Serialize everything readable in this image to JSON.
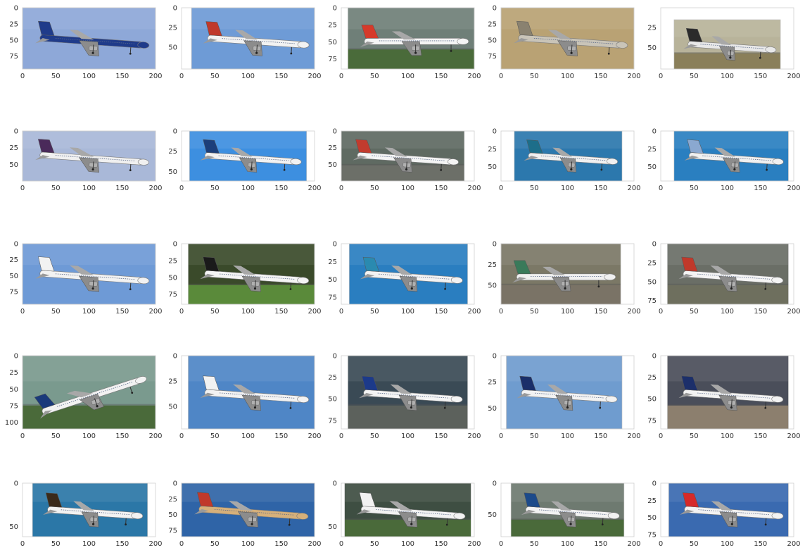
{
  "chart_data": {
    "type": "image_grid",
    "grid": {
      "rows": 5,
      "cols": 5
    },
    "axes_frame": false,
    "grid_lines": false,
    "panels": [
      {
        "xlim": [
          0,
          200
        ],
        "ylim": [
          95,
          0
        ],
        "image_extent": [
          0,
          200,
          0,
          95
        ],
        "x_ticks": [
          0,
          50,
          100,
          150,
          200
        ],
        "y_ticks": [
          0,
          25,
          50,
          75
        ],
        "sky": "#8ea8d8",
        "ground": null,
        "fuselage": "#1f3b8a",
        "tail": "#1f3b8a"
      },
      {
        "xlim": [
          0,
          200
        ],
        "ylim": [
          78,
          0
        ],
        "image_extent": [
          15,
          200,
          0,
          78
        ],
        "x_ticks": [
          0,
          50,
          100,
          150,
          200
        ],
        "y_ticks": [
          0,
          25,
          50
        ],
        "sky": "#6e9bd6",
        "ground": null,
        "fuselage": "#f2f2f2",
        "tail": "#c0392b"
      },
      {
        "xlim": [
          0,
          200
        ],
        "ylim": [
          90,
          0
        ],
        "image_extent": [
          10,
          200,
          0,
          90
        ],
        "x_ticks": [
          0,
          50,
          100,
          150,
          200
        ],
        "y_ticks": [
          0,
          25,
          50,
          75
        ],
        "sky": "#6f7f78",
        "ground": "#4a6b3a",
        "fuselage": "#f4f4f4",
        "tail": "#d63a2a"
      },
      {
        "xlim": [
          0,
          200
        ],
        "ylim": [
          95,
          0
        ],
        "image_extent": [
          0,
          200,
          0,
          95
        ],
        "x_ticks": [
          0,
          50,
          100,
          150,
          200
        ],
        "y_ticks": [
          0,
          25,
          50,
          75
        ],
        "sky": "#b9a274",
        "ground": null,
        "fuselage": "#c9c4b8",
        "tail": "#8a8270"
      },
      {
        "xlim": [
          0,
          200
        ],
        "ylim": [
          77,
          0
        ],
        "image_extent": [
          20,
          180,
          15,
          77
        ],
        "x_ticks": [
          0,
          50,
          100,
          150,
          200
        ],
        "y_ticks": [
          25,
          50
        ],
        "sky": "#b8b39a",
        "ground": "#8a7f5a",
        "fuselage": "#e8e8e8",
        "tail": "#2b2b2b"
      },
      {
        "xlim": [
          0,
          200
        ],
        "ylim": [
          75,
          0
        ],
        "image_extent": [
          0,
          200,
          0,
          75
        ],
        "x_ticks": [
          0,
          50,
          100,
          150,
          200
        ],
        "y_ticks": [
          0,
          25,
          50
        ],
        "sky": "#a9b8d8",
        "ground": null,
        "fuselage": "#f0f0f0",
        "tail": "#4a2a5a"
      },
      {
        "xlim": [
          0,
          200
        ],
        "ylim": [
          62,
          0
        ],
        "image_extent": [
          12,
          188,
          0,
          62
        ],
        "x_ticks": [
          0,
          50,
          100,
          150,
          200
        ],
        "y_ticks": [
          0,
          25,
          50
        ],
        "sky": "#3d8fe0",
        "ground": null,
        "fuselage": "#f2f2f2",
        "tail": "#1c3f7a"
      },
      {
        "xlim": [
          0,
          200
        ],
        "ylim": [
          75,
          0
        ],
        "image_extent": [
          0,
          185,
          0,
          75
        ],
        "x_ticks": [
          0,
          50,
          100,
          150,
          200
        ],
        "y_ticks": [
          0,
          25,
          50
        ],
        "sky": "#5f6a62",
        "ground": "#6c6f68",
        "fuselage": "#f4f4f4",
        "tail": "#c23b2e"
      },
      {
        "xlim": [
          0,
          200
        ],
        "ylim": [
          70,
          0
        ],
        "image_extent": [
          20,
          182,
          0,
          70
        ],
        "x_ticks": [
          0,
          50,
          100,
          150,
          200
        ],
        "y_ticks": [
          0,
          25,
          50
        ],
        "sky": "#2c78ad",
        "ground": null,
        "fuselage": "#f0f0f0",
        "tail": "#1d6e8a"
      },
      {
        "xlim": [
          0,
          200
        ],
        "ylim": [
          70,
          0
        ],
        "image_extent": [
          20,
          192,
          0,
          70
        ],
        "x_ticks": [
          0,
          50,
          100,
          150,
          200
        ],
        "y_ticks": [
          0,
          25,
          50
        ],
        "sky": "#2a7fc0",
        "ground": null,
        "fuselage": "#f0f0f0",
        "tail": "#8aa8d0"
      },
      {
        "xlim": [
          0,
          200
        ],
        "ylim": [
          95,
          0
        ],
        "image_extent": [
          0,
          200,
          0,
          95
        ],
        "x_ticks": [
          0,
          50,
          100,
          150,
          200
        ],
        "y_ticks": [
          0,
          25,
          50,
          75
        ],
        "sky": "#6e9ad6",
        "ground": null,
        "fuselage": "#f2f2f2",
        "tail": "#f2f2f2"
      },
      {
        "xlim": [
          0,
          200
        ],
        "ylim": [
          90,
          0
        ],
        "image_extent": [
          10,
          200,
          0,
          90
        ],
        "x_ticks": [
          0,
          50,
          100,
          150,
          200
        ],
        "y_ticks": [
          0,
          25,
          50,
          75
        ],
        "sky": "#3a4a2a",
        "ground": "#5a8a3a",
        "fuselage": "#f4f4f4",
        "tail": "#1a1a1a"
      },
      {
        "xlim": [
          0,
          200
        ],
        "ylim": [
          85,
          0
        ],
        "image_extent": [
          12,
          190,
          0,
          85
        ],
        "x_ticks": [
          0,
          50,
          100,
          150,
          200
        ],
        "y_ticks": [
          0,
          25,
          50,
          75
        ],
        "sky": "#2a7ec0",
        "ground": null,
        "fuselage": "#f2f2f2",
        "tail": "#2a8ab0"
      },
      {
        "xlim": [
          0,
          200
        ],
        "ylim": [
          73,
          0
        ],
        "image_extent": [
          0,
          180,
          0,
          73
        ],
        "x_ticks": [
          0,
          50,
          100,
          150,
          200
        ],
        "y_ticks": [
          0,
          25,
          50
        ],
        "sky": "#7b7866",
        "ground": "#7a7366",
        "fuselage": "#f0f0f0",
        "tail": "#3a7a5a"
      },
      {
        "xlim": [
          0,
          200
        ],
        "ylim": [
          80,
          0
        ],
        "image_extent": [
          10,
          192,
          0,
          80
        ],
        "x_ticks": [
          0,
          50,
          100,
          150,
          200
        ],
        "y_ticks": [
          0,
          25,
          50,
          75
        ],
        "sky": "#6a6e66",
        "ground": "#6e6f5e",
        "fuselage": "#f4f4f4",
        "tail": "#c0392b"
      },
      {
        "xlim": [
          0,
          200
        ],
        "ylim": [
          110,
          0
        ],
        "image_extent": [
          0,
          200,
          0,
          110
        ],
        "x_ticks": [
          0,
          50,
          100,
          150,
          200
        ],
        "y_ticks": [
          0,
          25,
          50,
          75,
          100
        ],
        "sky": "#7a9a8e",
        "ground": "#4a6a3a",
        "fuselage": "#f2f2f2",
        "tail": "#1a3a7a"
      },
      {
        "xlim": [
          0,
          200
        ],
        "ylim": [
          72,
          0
        ],
        "image_extent": [
          10,
          200,
          0,
          72
        ],
        "x_ticks": [
          0,
          50,
          100,
          150,
          200
        ],
        "y_ticks": [
          0,
          25,
          50
        ],
        "sky": "#4f86c6",
        "ground": null,
        "fuselage": "#f2f2f2",
        "tail": "#f2f2f2"
      },
      {
        "xlim": [
          0,
          200
        ],
        "ylim": [
          85,
          0
        ],
        "image_extent": [
          10,
          190,
          0,
          85
        ],
        "x_ticks": [
          0,
          50,
          100,
          150,
          200
        ],
        "y_ticks": [
          0,
          25,
          50,
          75
        ],
        "sky": "#3a4a55",
        "ground": "#5c615c",
        "fuselage": "#f4f4f4",
        "tail": "#1c3a8a"
      },
      {
        "xlim": [
          0,
          200
        ],
        "ylim": [
          70,
          0
        ],
        "image_extent": [
          8,
          182,
          0,
          70
        ],
        "x_ticks": [
          0,
          50,
          100,
          150,
          200
        ],
        "y_ticks": [
          0,
          25,
          50
        ],
        "sky": "#6f9ccf",
        "ground": null,
        "fuselage": "#f2f2f2",
        "tail": "#1a2f6a"
      },
      {
        "xlim": [
          0,
          200
        ],
        "ylim": [
          85,
          0
        ],
        "image_extent": [
          10,
          192,
          0,
          85
        ],
        "x_ticks": [
          0,
          50,
          100,
          150,
          200
        ],
        "y_ticks": [
          0,
          25,
          50,
          75
        ],
        "sky": "#4a4e5a",
        "ground": "#8c7f6e",
        "fuselage": "#f2f2f2",
        "tail": "#1c2f6a"
      },
      {
        "xlim": [
          0,
          200
        ],
        "ylim": [
          62,
          0
        ],
        "image_extent": [
          15,
          188,
          0,
          62
        ],
        "x_ticks": [
          0,
          50,
          100,
          150,
          200
        ],
        "y_ticks": [
          0,
          50
        ],
        "sky": "#2b77a7",
        "ground": null,
        "fuselage": "#f2f2f2",
        "tail": "#3a2a1a"
      },
      {
        "xlim": [
          0,
          200
        ],
        "ylim": [
          85,
          0
        ],
        "image_extent": [
          0,
          200,
          0,
          85
        ],
        "x_ticks": [
          0,
          50,
          100,
          150,
          200
        ],
        "y_ticks": [
          0,
          25,
          50,
          75
        ],
        "sky": "#2f64a7",
        "ground": null,
        "fuselage": "#d6b07a",
        "tail": "#c0392b"
      },
      {
        "xlim": [
          0,
          200
        ],
        "ylim": [
          62,
          0
        ],
        "image_extent": [
          5,
          195,
          0,
          62
        ],
        "x_ticks": [
          0,
          50,
          100,
          150,
          200
        ],
        "y_ticks": [
          0,
          50
        ],
        "sky": "#3e4e42",
        "ground": "#4a6a3a",
        "fuselage": "#f2f2f2",
        "tail": "#f2f2f2"
      },
      {
        "xlim": [
          0,
          200
        ],
        "ylim": [
          85,
          0
        ],
        "image_extent": [
          15,
          185,
          0,
          85
        ],
        "x_ticks": [
          0,
          50,
          100,
          150,
          200
        ],
        "y_ticks": [
          0,
          50
        ],
        "sky": "#6e7a70",
        "ground": "#4a6a3a",
        "fuselage": "#f2f2f2",
        "tail": "#1c4a8a"
      },
      {
        "xlim": [
          0,
          200
        ],
        "ylim": [
          78,
          0
        ],
        "image_extent": [
          12,
          192,
          0,
          78
        ],
        "x_ticks": [
          0,
          50,
          100,
          150,
          200
        ],
        "y_ticks": [
          0,
          25,
          50,
          75
        ],
        "sky": "#3a6ab0",
        "ground": null,
        "fuselage": "#f2f2f2",
        "tail": "#d62a2a"
      }
    ]
  }
}
